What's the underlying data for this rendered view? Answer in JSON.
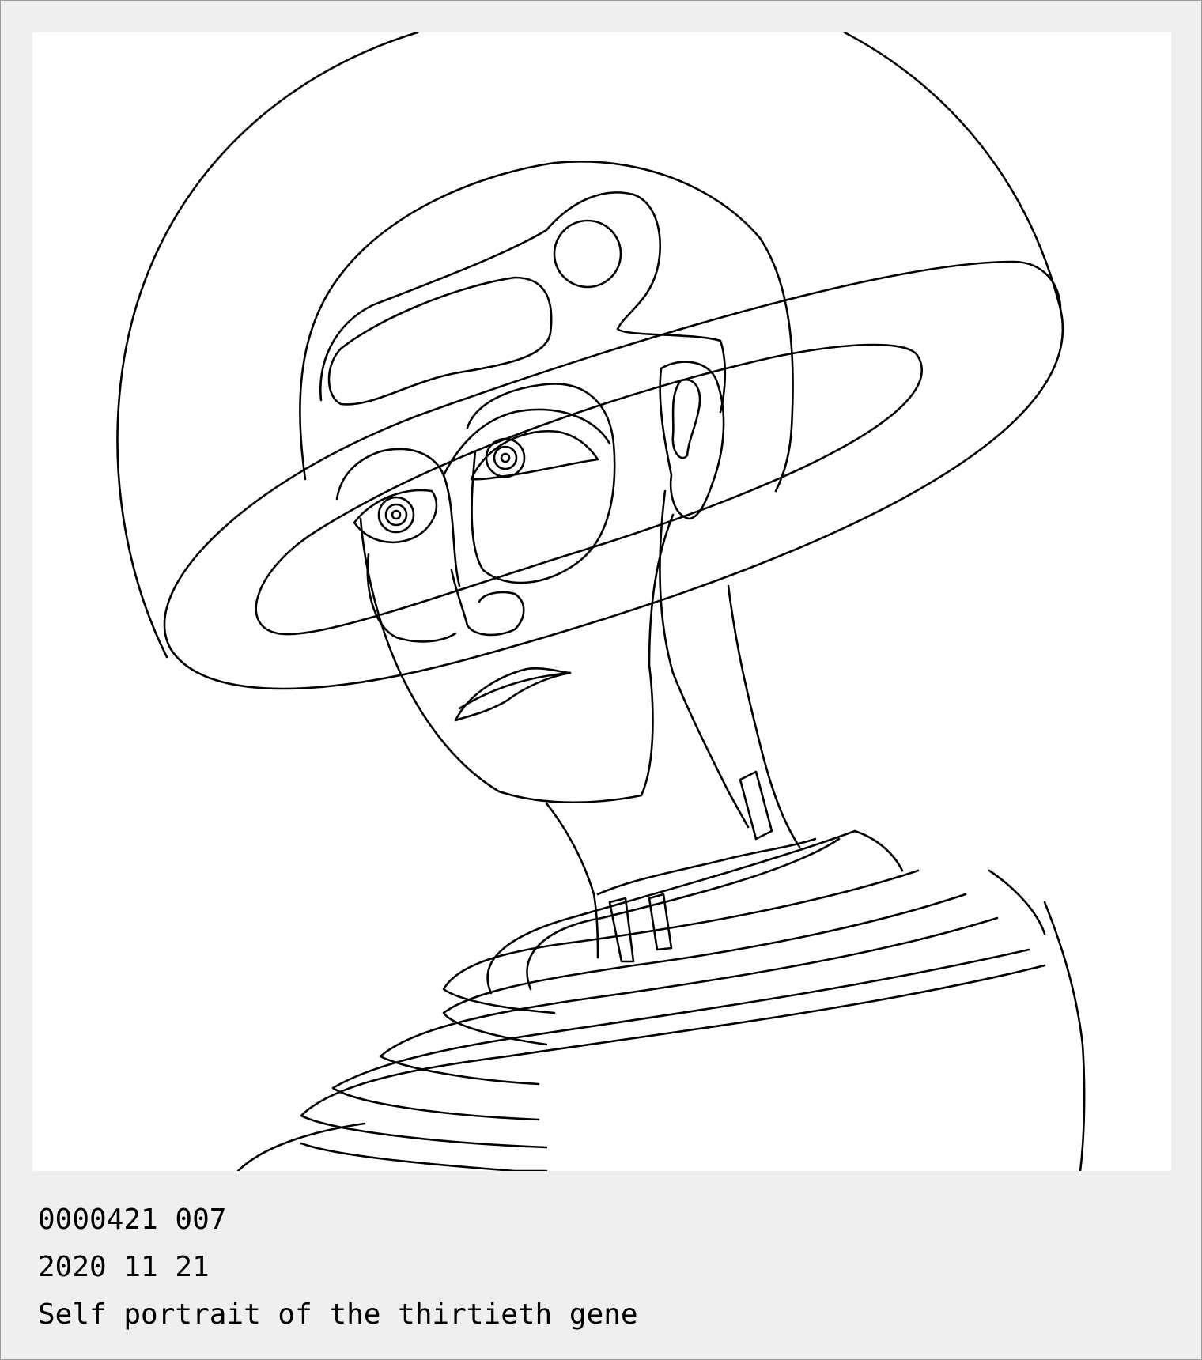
{
  "artwork": {
    "icon": "line-art-portrait"
  },
  "caption": {
    "serial": "0000421 007",
    "date": "2020 11 21",
    "title": "Self portrait of the thirtieth gene"
  },
  "colors": {
    "frame": "#efefef",
    "canvas": "#ffffff",
    "ink": "#000000"
  }
}
